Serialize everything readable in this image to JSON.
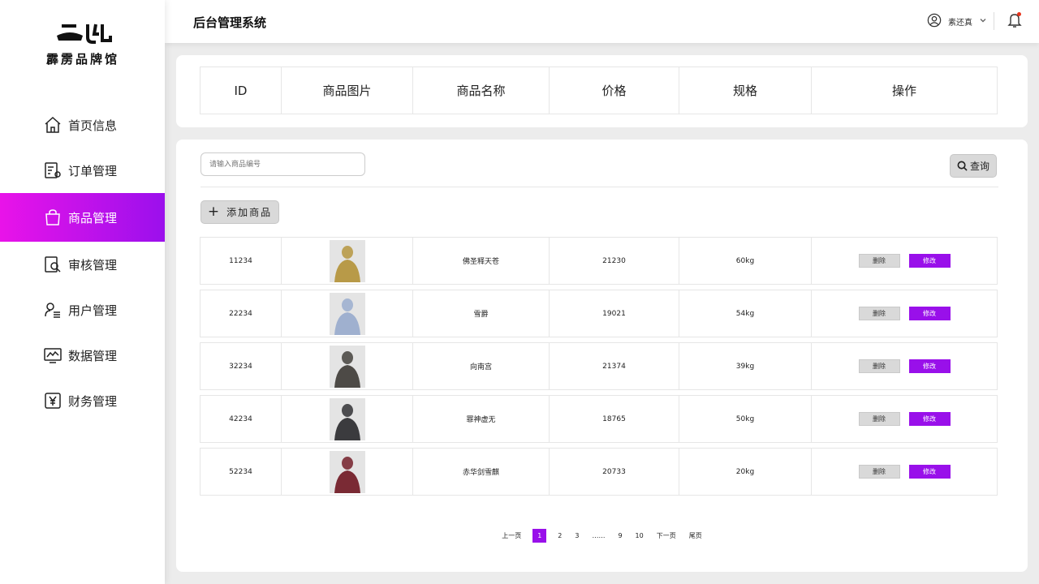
{
  "brand": {
    "mark": "二门",
    "name": "霹雳品牌馆"
  },
  "header": {
    "title": "后台管理系统",
    "user": "素还真"
  },
  "nav": [
    {
      "label": "首页信息",
      "icon": "home-icon"
    },
    {
      "label": "订单管理",
      "icon": "order-settings-icon"
    },
    {
      "label": "商品管理",
      "icon": "shopping-bag-icon",
      "active": true
    },
    {
      "label": "审核管理",
      "icon": "review-search-icon"
    },
    {
      "label": "用户管理",
      "icon": "user-list-icon"
    },
    {
      "label": "数据管理",
      "icon": "monitor-chart-icon"
    },
    {
      "label": "财务管理",
      "icon": "yen-icon"
    }
  ],
  "table": {
    "columns": [
      "ID",
      "商品图片",
      "商品名称",
      "价格",
      "规格",
      "操作"
    ],
    "rows": [
      {
        "id": "11234",
        "name": "佛圣释天苍",
        "price": "21230",
        "spec": "60kg",
        "thumb_color": "#b89a48"
      },
      {
        "id": "22234",
        "name": "雪爵",
        "price": "19021",
        "spec": "54kg",
        "thumb_color": "#9fb0cf"
      },
      {
        "id": "32234",
        "name": "向南宫",
        "price": "21374",
        "spec": "39kg",
        "thumb_color": "#4d4a46"
      },
      {
        "id": "42234",
        "name": "罪神虚无",
        "price": "18765",
        "spec": "50kg",
        "thumb_color": "#3b3b3e"
      },
      {
        "id": "52234",
        "name": "赤华剑雪麒",
        "price": "20733",
        "spec": "20kg",
        "thumb_color": "#7a2a34"
      }
    ],
    "delete_label": "删除",
    "edit_label": "修改"
  },
  "search": {
    "placeholder": "请输入商品编号",
    "button": "查询"
  },
  "add_label": "添加商品",
  "pagination": {
    "prev": "上一页",
    "pages": [
      "1",
      "2",
      "3",
      "……",
      "9",
      "10"
    ],
    "current": "1",
    "next": "下一页",
    "last": "尾页"
  },
  "colors": {
    "accent": "#9910ea",
    "accent_gradient_start": "#e913e9"
  }
}
